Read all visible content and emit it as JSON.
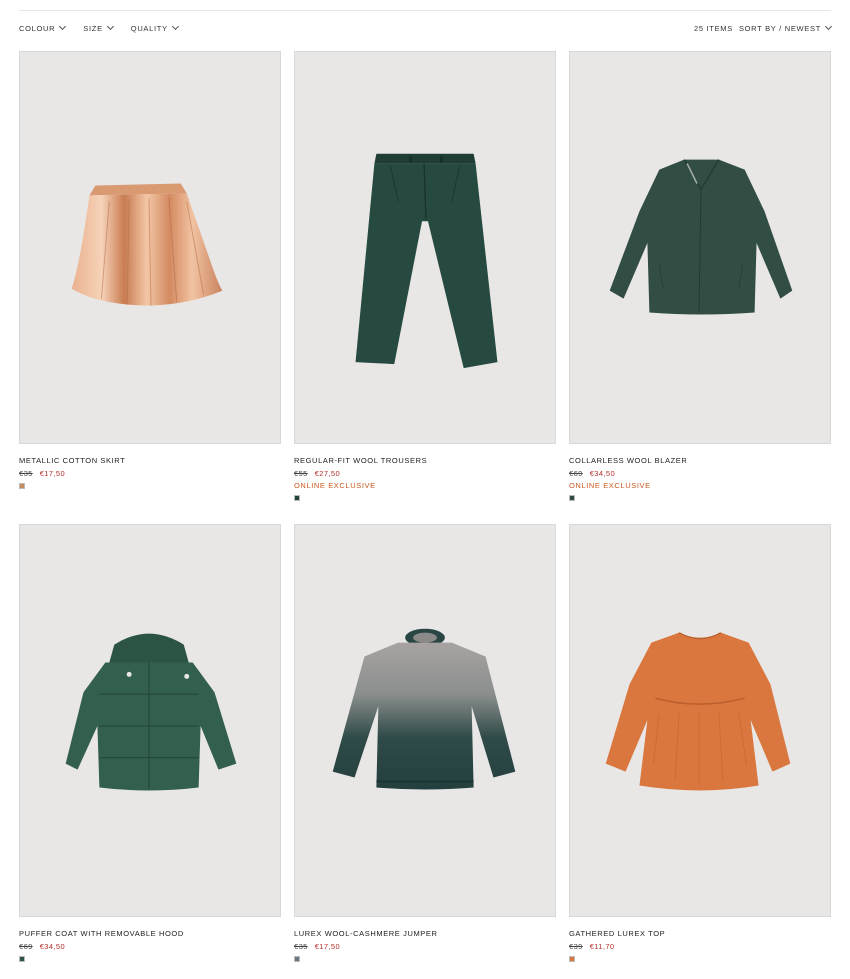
{
  "filters": [
    {
      "label": "COLOUR"
    },
    {
      "label": "SIZE"
    },
    {
      "label": "QUALITY"
    }
  ],
  "items_count": "25 ITEMS",
  "sort_label": "SORT BY / NEWEST",
  "products": [
    {
      "name": "METALLIC COTTON SKIRT",
      "old_price": "€35",
      "new_price": "€17,50",
      "badge": "",
      "swatch_color": "#c98a5e",
      "garment": "skirt"
    },
    {
      "name": "REGULAR-FIT WOOL TROUSERS",
      "old_price": "€55",
      "new_price": "€27,50",
      "badge": "ONLINE EXCLUSIVE",
      "swatch_color": "#23423a",
      "garment": "trousers"
    },
    {
      "name": "COLLARLESS WOOL BLAZER",
      "old_price": "€69",
      "new_price": "€34,50",
      "badge": "ONLINE EXCLUSIVE",
      "swatch_color": "#2e4a40",
      "garment": "blazer"
    },
    {
      "name": "PUFFER COAT WITH REMOVABLE HOOD",
      "old_price": "€69",
      "new_price": "€34,50",
      "badge": "",
      "swatch_color": "#2f5545",
      "garment": "puffer-coat"
    },
    {
      "name": "LUREX WOOL-CASHMERE JUMPER",
      "old_price": "€35",
      "new_price": "€17,50",
      "badge": "",
      "swatch_color": "#6b7588",
      "garment": "jumper"
    },
    {
      "name": "GATHERED LUREX TOP",
      "old_price": "€39",
      "new_price": "€11,70",
      "badge": "",
      "swatch_color": "#d9773e",
      "garment": "top"
    }
  ]
}
